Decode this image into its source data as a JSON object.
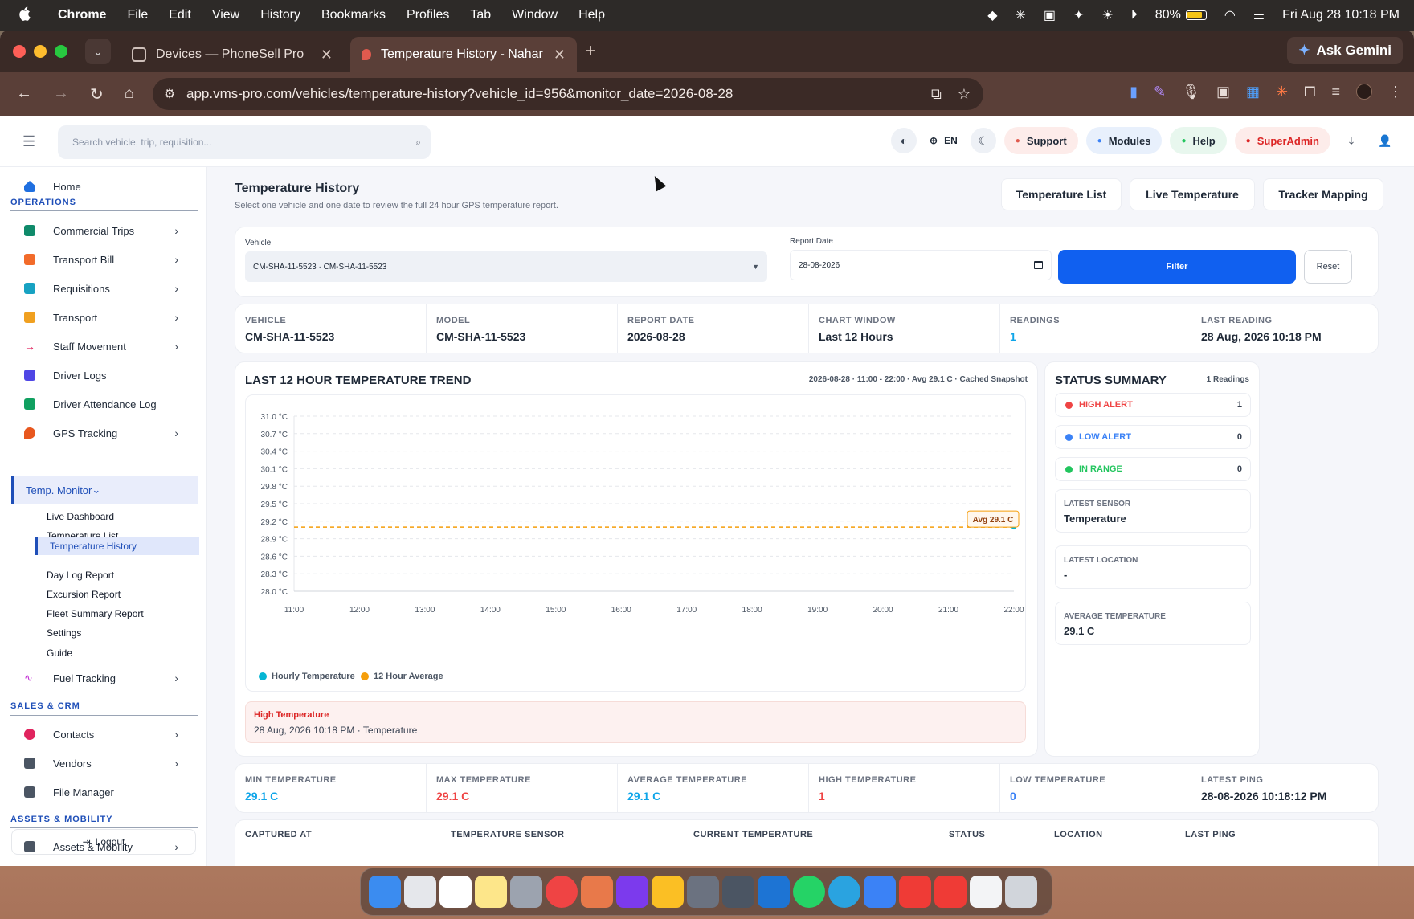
{
  "menubar": {
    "apple": "",
    "app": "Chrome",
    "items": [
      "File",
      "Edit",
      "View",
      "History",
      "Bookmarks",
      "Profiles",
      "Tab",
      "Window",
      "Help"
    ],
    "battery": "80%",
    "datetime": "Fri Aug 28  10:18 PM"
  },
  "browser": {
    "tabs": [
      {
        "title": "Devices — PhoneSell Pro"
      },
      {
        "title": "Temperature History - Nahar"
      }
    ],
    "gemini": "Ask Gemini",
    "url": "app.vms-pro.com/vehicles/temperature-history?vehicle_id=956&monitor_date=2026-08-28"
  },
  "header": {
    "search_placeholder": "Search vehicle, trip, requisition...",
    "lang": "EN",
    "support": "Support",
    "modules": "Modules",
    "help": "Help",
    "superadmin": "SuperAdmin"
  },
  "sidebar": {
    "home": "Home",
    "section_operations": "OPERATIONS",
    "ops": [
      "Commercial Trips",
      "Transport Bill",
      "Requisitions",
      "Transport",
      "Staff Movement",
      "Driver Logs",
      "Driver Attendance Log",
      "GPS Tracking"
    ],
    "temp_monitor": "Temp. Monitor",
    "temp_sub": [
      "Live Dashboard",
      "Temperature List",
      "Temperature History",
      "Day Log Report",
      "Excursion Report",
      "Fleet Summary Report",
      "Settings",
      "Guide"
    ],
    "fuel": "Fuel Tracking",
    "section_sales": "SALES & CRM",
    "sales": [
      "Contacts",
      "Vendors",
      "File Manager"
    ],
    "section_assets": "ASSETS & MOBILITY",
    "assets": [
      "Assets & Mobility"
    ],
    "logout": "Logout"
  },
  "page": {
    "title": "Temperature History",
    "subtitle": "Select one vehicle and one date to review the full 24 hour GPS temperature report.",
    "tabs": [
      "Temperature List",
      "Live Temperature",
      "Tracker Mapping"
    ]
  },
  "filter": {
    "vehicle_label": "Vehicle",
    "vehicle_value": "CM-SHA-11-5523 · CM-SHA-11-5523",
    "date_label": "Report Date",
    "date_value": "28-08-2026",
    "filter_btn": "Filter",
    "reset_btn": "Reset"
  },
  "info": [
    {
      "label": "VEHICLE",
      "value": "CM-SHA-11-5523"
    },
    {
      "label": "MODEL",
      "value": "CM-SHA-11-5523"
    },
    {
      "label": "REPORT DATE",
      "value": "2026-08-28"
    },
    {
      "label": "CHART WINDOW",
      "value": "Last 12 Hours"
    },
    {
      "label": "READINGS",
      "value": "1"
    },
    {
      "label": "LAST READING",
      "value": "28 Aug, 2026 10:18 PM"
    }
  ],
  "trend": {
    "title": "LAST 12 HOUR TEMPERATURE TREND",
    "meta": "2026-08-28 · 11:00 - 22:00 · Avg 29.1 C · Cached Snapshot",
    "avg_tag": "Avg 29.1 C",
    "legend": [
      "Hourly Temperature",
      "12 Hour Average"
    ],
    "alert_title": "High Temperature",
    "alert_text": "28 Aug, 2026 10:18 PM · Temperature"
  },
  "chart_data": {
    "type": "line",
    "xlabel": "",
    "ylabel": "",
    "x_ticks": [
      "11:00",
      "12:00",
      "13:00",
      "14:00",
      "15:00",
      "16:00",
      "17:00",
      "18:00",
      "19:00",
      "20:00",
      "21:00",
      "22:00"
    ],
    "y_ticks": [
      "31.0 °C",
      "30.7 °C",
      "30.4 °C",
      "30.1 °C",
      "29.8 °C",
      "29.5 °C",
      "29.2 °C",
      "28.9 °C",
      "28.6 °C",
      "28.3 °C",
      "28.0 °C"
    ],
    "ylim": [
      28.0,
      31.0
    ],
    "series": [
      {
        "name": "Hourly Temperature",
        "color": "#06b6d4",
        "points": [
          {
            "x": "22:18",
            "y": 29.1
          }
        ]
      },
      {
        "name": "12 Hour Average",
        "color": "#f59e0b",
        "value": 29.1
      }
    ],
    "grid": true,
    "legend": "bottom-left"
  },
  "status": {
    "title": "STATUS SUMMARY",
    "count": "1 Readings",
    "rows": [
      {
        "label": "HIGH ALERT",
        "value": "1",
        "color": "#ef4444"
      },
      {
        "label": "LOW ALERT",
        "value": "0",
        "color": "#3b82f6"
      },
      {
        "label": "IN RANGE",
        "value": "0",
        "color": "#22c55e"
      }
    ],
    "boxes": [
      {
        "label": "LATEST SENSOR",
        "value": "Temperature"
      },
      {
        "label": "LATEST LOCATION",
        "value": "-"
      },
      {
        "label": "AVERAGE TEMPERATURE",
        "value": "29.1 C"
      }
    ]
  },
  "summary": [
    {
      "label": "MIN TEMPERATURE",
      "value": "29.1 C",
      "color": "#0ea5e9"
    },
    {
      "label": "MAX TEMPERATURE",
      "value": "29.1 C",
      "color": "#ef4444"
    },
    {
      "label": "AVERAGE TEMPERATURE",
      "value": "29.1 C",
      "color": "#0ea5e9"
    },
    {
      "label": "HIGH TEMPERATURE",
      "value": "1",
      "color": "#ef4444"
    },
    {
      "label": "LOW TEMPERATURE",
      "value": "0",
      "color": "#3b82f6"
    },
    {
      "label": "LATEST PING",
      "value": "28-08-2026 10:18:12 PM",
      "color": "#1f2937"
    }
  ],
  "table": {
    "headers": [
      "CAPTURED AT",
      "TEMPERATURE SENSOR",
      "CURRENT TEMPERATURE",
      "STATUS",
      "LOCATION",
      "LAST PING"
    ]
  }
}
